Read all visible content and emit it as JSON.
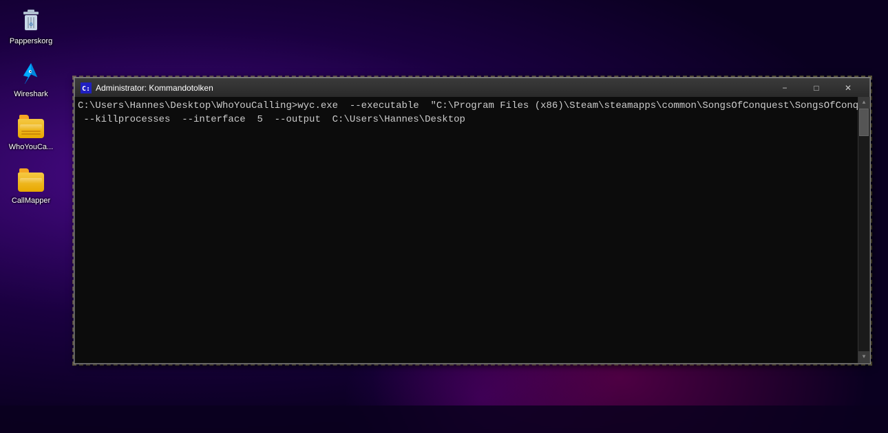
{
  "desktop": {
    "icons": [
      {
        "id": "papperskorg",
        "label": "Papperskorg",
        "type": "recycle-bin"
      },
      {
        "id": "wireshark",
        "label": "Wireshark",
        "type": "wireshark"
      },
      {
        "id": "whoyoucalling",
        "label": "WhoYouCa...",
        "type": "folder"
      },
      {
        "id": "callmapper",
        "label": "CallMapper",
        "type": "folder"
      }
    ]
  },
  "cmd_window": {
    "title": "Administrator: Kommandotolken",
    "title_icon": "cmd-icon",
    "controls": {
      "minimize": "−",
      "maximize": "□",
      "close": "✕"
    },
    "content_line1": "C:\\Users\\Hannes\\Desktop\\WhoYouCalling>wyc.exe  --executable  \"C:\\Program Files (x86)\\Steam\\steamapps\\common\\SongsOfConquest\\SongsOfConquest.exe\"",
    "content_line2": " --killprocesses  --interface  5  --output  C:\\Users\\Hannes\\Desktop"
  }
}
